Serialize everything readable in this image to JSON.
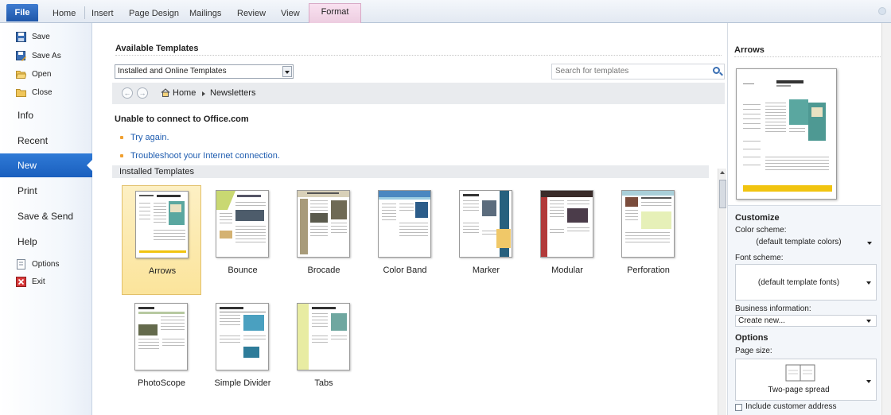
{
  "ribbon": {
    "tabs": [
      "File",
      "Home",
      "Insert",
      "Page Design",
      "Mailings",
      "Review",
      "View",
      "Format"
    ]
  },
  "nav": {
    "commands": [
      {
        "label": "Save",
        "icon": "save-icon"
      },
      {
        "label": "Save As",
        "icon": "save-as-icon"
      },
      {
        "label": "Open",
        "icon": "open-folder-icon"
      },
      {
        "label": "Close",
        "icon": "close-folder-icon"
      }
    ],
    "items": [
      "Info",
      "Recent",
      "New",
      "Print",
      "Save & Send",
      "Help"
    ],
    "active_item": "New",
    "bottom_commands": [
      {
        "label": "Options",
        "icon": "options-icon"
      },
      {
        "label": "Exit",
        "icon": "exit-icon"
      }
    ]
  },
  "main": {
    "title": "Available Templates",
    "source_select": "Installed and Online Templates",
    "search_placeholder": "Search for templates",
    "breadcrumb": [
      "Home",
      "Newsletters"
    ],
    "warning_title": "Unable to connect to Office.com",
    "links": [
      "Try again.",
      "Troubleshoot your Internet connection."
    ],
    "installed_header": "Installed Templates",
    "templates": [
      "Arrows",
      "Bounce",
      "Brocade",
      "Color Band",
      "Marker",
      "Modular",
      "Perforation",
      "PhotoScope",
      "Simple Divider",
      "Tabs"
    ],
    "selected_template": "Arrows"
  },
  "right": {
    "preview_title": "Arrows",
    "customize_header": "Customize",
    "color_scheme_label": "Color scheme:",
    "color_scheme_value": "(default template colors)",
    "font_scheme_label": "Font scheme:",
    "font_scheme_value": "(default template fonts)",
    "business_label": "Business information:",
    "business_value": "Create new...",
    "options_header": "Options",
    "page_size_label": "Page size:",
    "page_size_value": "Two-page spread",
    "include_address_label": "Include customer address"
  },
  "colors": {
    "accent_blue": "#1a5fbe",
    "selected_bg": "#fbe49b",
    "link": "#1f5db0",
    "bullet": "#f0a030",
    "format_tab": "#edcde0"
  }
}
